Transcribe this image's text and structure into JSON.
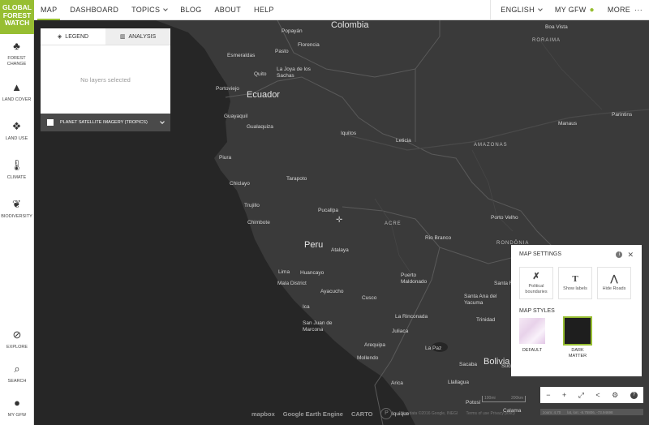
{
  "nav": {
    "items": [
      {
        "label": "MAP",
        "active": true
      },
      {
        "label": "DASHBOARD"
      },
      {
        "label": "TOPICS",
        "dropdown": true
      },
      {
        "label": "BLOG"
      },
      {
        "label": "ABOUT"
      },
      {
        "label": "HELP"
      }
    ],
    "language": "ENGLISH",
    "my_gfw": "MY GFW",
    "more": "MORE"
  },
  "sidebar": {
    "logo": [
      "GLOBAL",
      "FOREST",
      "WATCH"
    ],
    "items": [
      {
        "label": "FOREST CHANGE",
        "icon": "tree-icon"
      },
      {
        "label": "LAND COVER",
        "icon": "pine-icon"
      },
      {
        "label": "LAND USE",
        "icon": "landuse-icon"
      },
      {
        "label": "CLIMATE",
        "icon": "thermometer-icon"
      },
      {
        "label": "BIODIVERSITY",
        "icon": "paw-icon"
      }
    ],
    "bottom": [
      {
        "label": "EXPLORE",
        "icon": "compass-icon"
      },
      {
        "label": "SEARCH",
        "icon": "search-icon"
      },
      {
        "label": "MY GFW",
        "icon": "user-icon"
      }
    ]
  },
  "legend": {
    "tab_legend": "LEGEND",
    "tab_analysis": "ANALYSIS",
    "empty_text": "No layers selected",
    "basemap_label": "PLANET SATELLITE IMAGERY (TROPICS)"
  },
  "settings": {
    "title": "MAP SETTINGS",
    "toggles": [
      {
        "label": "Political boundaries",
        "icon": "boundaries-icon"
      },
      {
        "label": "Show labels",
        "icon": "text-icon"
      },
      {
        "label": "Hide Roads",
        "icon": "road-icon"
      }
    ],
    "styles_title": "MAP STYLES",
    "styles": [
      {
        "label": "DEFAULT",
        "selected": false
      },
      {
        "label": "DARK MATTER",
        "selected": true
      }
    ]
  },
  "map": {
    "countries": [
      {
        "label": "Colombia"
      },
      {
        "label": "Ecuador"
      },
      {
        "label": "Peru"
      },
      {
        "label": "Bolivia"
      }
    ],
    "regions": [
      {
        "label": "AMAZONAS"
      },
      {
        "label": "ACRE"
      },
      {
        "label": "RONDÔNIA"
      },
      {
        "label": "RORAIMA"
      }
    ],
    "cities": [
      {
        "label": "Popayán"
      },
      {
        "label": "Florencia"
      },
      {
        "label": "Pasto"
      },
      {
        "label": "Esmeraldas"
      },
      {
        "label": "Quito"
      },
      {
        "label": "La Joya de los Sachas"
      },
      {
        "label": "Portoviejo"
      },
      {
        "label": "Guayaquil"
      },
      {
        "label": "Gualaquiza"
      },
      {
        "label": "Iquitos"
      },
      {
        "label": "Leticia"
      },
      {
        "label": "Piura"
      },
      {
        "label": "Chiclayo"
      },
      {
        "label": "Tarapoto"
      },
      {
        "label": "Trujillo"
      },
      {
        "label": "Chimbote"
      },
      {
        "label": "Pucallpa"
      },
      {
        "label": "Atalaya"
      },
      {
        "label": "Rio Branco"
      },
      {
        "label": "Porto Velho"
      },
      {
        "label": "Lima"
      },
      {
        "label": "Huancayo"
      },
      {
        "label": "Mala District"
      },
      {
        "label": "Ayacucho"
      },
      {
        "label": "Puerto Maldonado"
      },
      {
        "label": "Cusco"
      },
      {
        "label": "Ica"
      },
      {
        "label": "San Juan de Marcona"
      },
      {
        "label": "La Rinconada"
      },
      {
        "label": "Juliaca"
      },
      {
        "label": "Arequipa"
      },
      {
        "label": "Mollendo"
      },
      {
        "label": "La Paz"
      },
      {
        "label": "Sucre"
      },
      {
        "label": "Arica"
      },
      {
        "label": "Llallagua"
      },
      {
        "label": "Potosí"
      },
      {
        "label": "Iquique"
      },
      {
        "label": "Calama"
      },
      {
        "label": "Manaus"
      },
      {
        "label": "Boa Vista"
      },
      {
        "label": "Parintins"
      },
      {
        "label": "Trinidad"
      },
      {
        "label": "Santa Ana del Yacuma"
      },
      {
        "label": "Santa Rosa"
      },
      {
        "label": "Sacaba"
      }
    ],
    "scale": [
      "100mi",
      "200km"
    ],
    "attribution": [
      "mapbox",
      "Google Earth Engine",
      "CARTO"
    ],
    "map_data": "Map data ©2016 Google, INEGI",
    "terms": "Terms of use  Privacy policy",
    "zoom": "zoom: 4.70",
    "latlon": "lat, lon: -8.75806, -73.94698"
  },
  "controls": [
    "−",
    "+",
    "⤢",
    "share-icon",
    "⚙",
    "?"
  ]
}
